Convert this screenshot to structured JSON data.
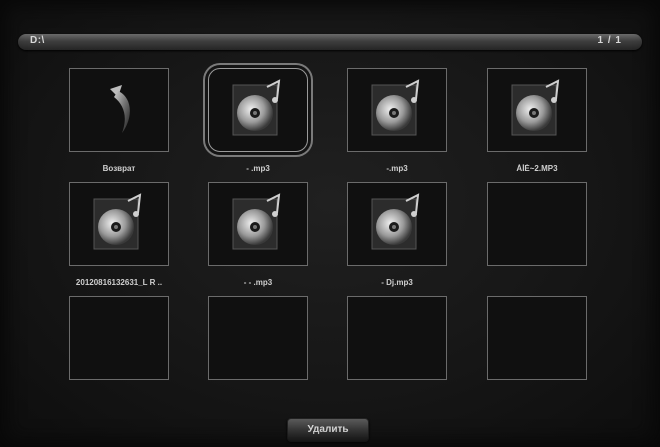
{
  "header": {
    "path": "D:\\",
    "page_indicator": "1 / 1"
  },
  "items": [
    {
      "type": "back",
      "icon": "return-arrow-icon",
      "label": "Возврат"
    },
    {
      "type": "audio",
      "icon": "music-file-icon",
      "label": "- .mp3",
      "selected": true
    },
    {
      "type": "audio",
      "icon": "music-file-icon",
      "label": "-.mp3"
    },
    {
      "type": "audio",
      "icon": "music-file-icon",
      "label": "ÀÌÉ~2.MP3"
    },
    {
      "type": "audio",
      "icon": "music-file-icon",
      "label": "20120816132631_L  R  .."
    },
    {
      "type": "audio",
      "icon": "music-file-icon",
      "label": "-   -   .mp3"
    },
    {
      "type": "audio",
      "icon": "music-file-icon",
      "label": "- Dj.mp3"
    },
    {
      "type": "empty"
    },
    {
      "type": "empty"
    },
    {
      "type": "empty"
    },
    {
      "type": "empty"
    },
    {
      "type": "empty"
    }
  ],
  "footer": {
    "delete_label": "Удалить"
  },
  "colors": {
    "background": "#151515",
    "tile_border": "#6b6b6b",
    "selected_border": "#9a9a9a",
    "text": "#cfcfcf"
  }
}
